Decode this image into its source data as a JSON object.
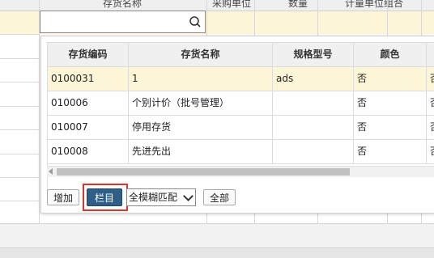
{
  "background": {
    "headers": [
      "",
      "存货名称",
      "采购单位",
      "数量",
      "计量单位组合",
      ""
    ]
  },
  "search": {
    "value": "",
    "placeholder": ""
  },
  "popup": {
    "columns": [
      "存货编码",
      "存货名称",
      "规格型号",
      "颜色",
      ""
    ],
    "rows": [
      {
        "code": "0100031",
        "name": "1",
        "spec": "ads",
        "color": "否",
        "extra": "否",
        "selected": true
      },
      {
        "code": "010006",
        "name": "个别计价（批号管理）",
        "spec": "",
        "color": "否",
        "extra": "否",
        "selected": false
      },
      {
        "code": "010007",
        "name": "停用存货",
        "spec": "",
        "color": "否",
        "extra": "否",
        "selected": false
      },
      {
        "code": "010008",
        "name": "先进先出",
        "spec": "",
        "color": "否",
        "extra": "否",
        "selected": false
      }
    ],
    "buttons": {
      "add": "增加",
      "columns": "栏目",
      "match": "全模糊匹配",
      "all": "全部"
    }
  },
  "colors": {
    "selected_row": "#fdf6d6",
    "primary_button": "#2f5e86",
    "highlight": "#d9362b"
  }
}
